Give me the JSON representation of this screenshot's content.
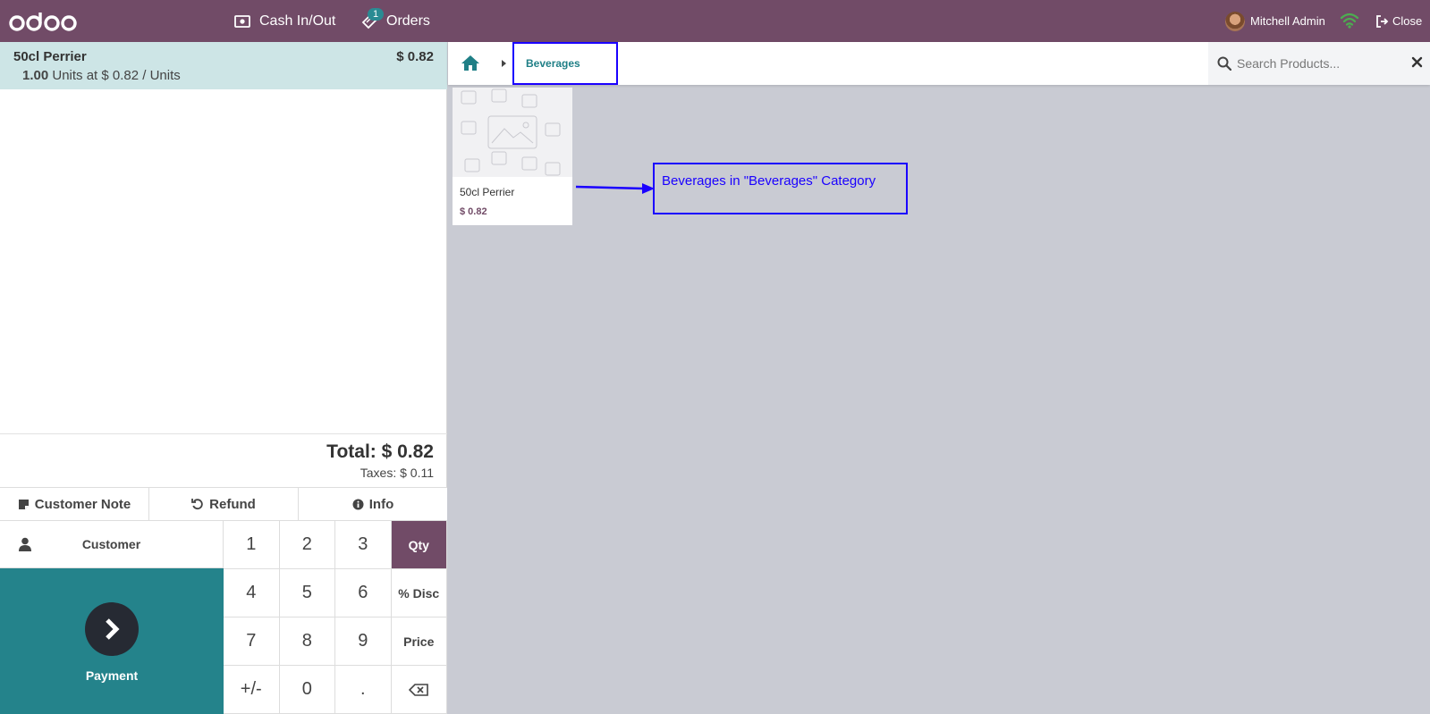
{
  "topbar": {
    "cash_label": "Cash In/Out",
    "orders_label": "Orders",
    "orders_badge": "1",
    "user_name": "Mitchell Admin",
    "close_label": "Close",
    "bg_color": "#714b67",
    "wifi_color": "#4caf50"
  },
  "order": {
    "lines": [
      {
        "name": "50cl Perrier",
        "price": "$ 0.82",
        "qty": "1.00",
        "detail": "Units at $ 0.82 / Units"
      }
    ],
    "total": "Total: $ 0.82",
    "taxes": "Taxes: $ 0.11"
  },
  "controls": {
    "customer_note": "Customer Note",
    "refund": "Refund",
    "info": "Info",
    "customer": "Customer",
    "payment": "Payment"
  },
  "numpad": {
    "keys": [
      "1",
      "2",
      "3",
      "Qty",
      "4",
      "5",
      "6",
      "% Disc",
      "7",
      "8",
      "9",
      "Price",
      "+/-",
      "0",
      ".",
      "⌫"
    ],
    "active": "Qty"
  },
  "category": {
    "current": "Beverages",
    "search_placeholder": "Search Products..."
  },
  "products": [
    {
      "name": "50cl Perrier",
      "price": "$ 0.82"
    }
  ],
  "annotation": {
    "text": "Beverages in \"Beverages\" Category",
    "color": "#1a00ff"
  },
  "icons": {
    "cash": "cash-icon",
    "orders": "ticket-icon",
    "wifi": "wifi-icon",
    "close": "sign-out-icon",
    "home": "home-icon",
    "search": "search-icon",
    "clear": "close-icon",
    "note": "sticky-note-icon",
    "refund": "undo-icon",
    "info": "info-icon",
    "user": "user-icon",
    "payment": "chevron-right-icon",
    "backspace": "backspace-icon"
  }
}
